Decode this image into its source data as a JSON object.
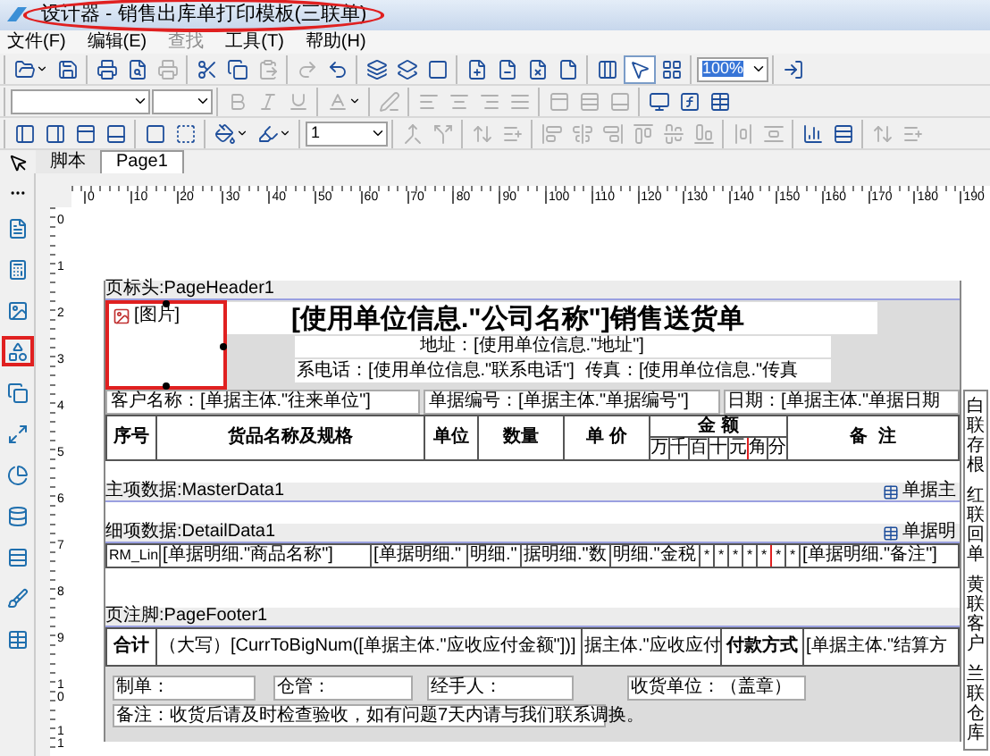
{
  "window": {
    "title": "设计器 - 销售出库单打印模板(三联单)",
    "title_circled": true
  },
  "menu": [
    {
      "label": "文件(F)",
      "disabled": false
    },
    {
      "label": "编辑(E)",
      "disabled": false
    },
    {
      "label": "查找",
      "disabled": true
    },
    {
      "label": "工具(T)",
      "disabled": false
    },
    {
      "label": "帮助(H)",
      "disabled": false
    }
  ],
  "toolbars": [
    [
      [
        {
          "kind": "button",
          "disabled": false,
          "caret": true
        },
        {
          "kind": "button",
          "disabled": false
        }
      ],
      [
        {
          "kind": "button",
          "disabled": false
        },
        {
          "kind": "button",
          "disabled": false
        },
        {
          "kind": "button",
          "disabled": true
        }
      ],
      [
        {
          "kind": "button",
          "disabled": false
        },
        {
          "kind": "button",
          "disabled": false
        },
        {
          "kind": "button",
          "disabled": true
        }
      ],
      [
        {
          "kind": "button",
          "disabled": true
        },
        {
          "kind": "button",
          "disabled": false
        }
      ],
      [
        {
          "kind": "button",
          "disabled": false
        },
        {
          "kind": "button",
          "disabled": false
        },
        {
          "kind": "button",
          "disabled": false
        }
      ],
      [
        {
          "kind": "button",
          "disabled": false
        },
        {
          "kind": "button",
          "disabled": false
        },
        {
          "kind": "button",
          "disabled": false
        },
        {
          "kind": "button",
          "disabled": false
        }
      ],
      [
        {
          "kind": "button",
          "disabled": false
        },
        {
          "kind": "button",
          "disabled": false,
          "pressed": true
        },
        {
          "kind": "button",
          "disabled": false
        }
      ],
      [
        {
          "kind": "select",
          "value": "100%",
          "highlighted": true
        }
      ],
      [
        {
          "kind": "button",
          "disabled": false
        }
      ]
    ],
    [
      [
        {
          "kind": "select"
        },
        {
          "kind": "select"
        }
      ],
      [
        {
          "kind": "button",
          "disabled": true
        },
        {
          "kind": "button",
          "disabled": true
        },
        {
          "kind": "button",
          "disabled": true
        }
      ],
      [
        {
          "kind": "button",
          "disabled": true,
          "caret": true
        }
      ],
      [
        {
          "kind": "button",
          "disabled": true
        }
      ],
      [
        {
          "kind": "button",
          "disabled": true
        },
        {
          "kind": "button",
          "disabled": true
        },
        {
          "kind": "button",
          "disabled": true
        },
        {
          "kind": "button",
          "disabled": true
        }
      ],
      [
        {
          "kind": "button",
          "disabled": true
        },
        {
          "kind": "button",
          "disabled": true
        },
        {
          "kind": "button",
          "disabled": true
        }
      ],
      [
        {
          "kind": "button",
          "disabled": false
        },
        {
          "kind": "button",
          "disabled": false
        },
        {
          "kind": "button",
          "disabled": false
        }
      ]
    ],
    [
      [
        {
          "kind": "button",
          "disabled": false
        },
        {
          "kind": "button",
          "disabled": false
        },
        {
          "kind": "button",
          "disabled": false
        },
        {
          "kind": "button",
          "disabled": false
        }
      ],
      [
        {
          "kind": "button",
          "disabled": false
        },
        {
          "kind": "button",
          "disabled": false
        }
      ],
      [
        {
          "kind": "button",
          "disabled": false,
          "caret": true
        },
        {
          "kind": "button",
          "disabled": false,
          "caret": true
        }
      ],
      [
        {
          "kind": "select",
          "value": "1",
          "highlighted": false
        }
      ],
      [
        {
          "kind": "button",
          "disabled": true
        },
        {
          "kind": "button",
          "disabled": true
        }
      ],
      [
        {
          "kind": "button",
          "disabled": true
        },
        {
          "kind": "button",
          "disabled": true
        }
      ],
      [
        {
          "kind": "button",
          "disabled": true
        },
        {
          "kind": "button",
          "disabled": true
        },
        {
          "kind": "button",
          "disabled": true
        },
        {
          "kind": "button",
          "disabled": true
        },
        {
          "kind": "button",
          "disabled": true
        },
        {
          "kind": "button",
          "disabled": true
        }
      ],
      [
        {
          "kind": "button",
          "disabled": true
        },
        {
          "kind": "button",
          "disabled": true
        }
      ],
      [
        {
          "kind": "button",
          "disabled": false
        },
        {
          "kind": "button",
          "disabled": false
        }
      ],
      [
        {
          "kind": "button",
          "disabled": true
        },
        {
          "kind": "button",
          "disabled": true
        }
      ]
    ]
  ],
  "tabs": [
    {
      "label": "脚本",
      "selected": false
    },
    {
      "label": "Page1",
      "selected": true
    }
  ],
  "palette": [
    {
      "selected": false
    },
    {
      "selected": false
    },
    {
      "selected": false
    },
    {
      "selected": true
    },
    {
      "selected": false
    },
    {
      "selected": false
    },
    {
      "selected": false
    },
    {
      "selected": false
    },
    {
      "selected": false
    },
    {
      "selected": false
    },
    {
      "selected": false
    }
  ],
  "ruler": {
    "horizontal": [
      "0",
      "10",
      "20",
      "30",
      "40",
      "50",
      "60",
      "70",
      "80",
      "90",
      "100",
      "110",
      "120",
      "130",
      "140",
      "150",
      "160",
      "170",
      "180",
      "190"
    ],
    "vertical": [
      "0",
      "1",
      "2",
      "3",
      "4",
      "5",
      "6",
      "7",
      "8",
      "9",
      "10",
      "11"
    ]
  },
  "page_header": {
    "label": "页标头:PageHeader1",
    "image": {
      "label": "[图片]",
      "selected": true
    },
    "title": "[使用单位信息.\"公司名称\"]销售送货单",
    "address": "地址：[使用单位信息.\"地址\"]",
    "phone": "系电话：[使用单位信息.\"联系电话\"]",
    "fax": "传真：[使用单位信息.\"传真",
    "customer": "客户名称：[单据主体.\"往来单位\"]",
    "number": "单据编号：[单据主体.\"单据编号\"]",
    "date": "日期：[单据主体.\"单据日期"
  },
  "table_header": {
    "columns": [
      "序号",
      "货品名称及规格",
      "单位",
      "数量",
      "单 价"
    ],
    "amount": {
      "label": "金 额",
      "digits": [
        "万",
        "千",
        "百",
        "十",
        "元",
        "角",
        "分"
      ]
    },
    "remark": "备  注"
  },
  "master": {
    "label": "主项数据:MasterData1",
    "tag": "单据主"
  },
  "detail": {
    "label": "细项数据:DetailData1",
    "tag": "单据明",
    "cells": [
      "RM_Lin",
      "[单据明细.\"商品名称\"]",
      "[单据明细.\"",
      "明细.\"",
      "据明细.\"数",
      "明细.\"金税"
    ],
    "digits": [
      "*",
      "*",
      "*",
      "*",
      "*",
      "*",
      "*"
    ],
    "remark": "[单据明细.\"备注\"]"
  },
  "page_footer": {
    "label": "页注脚:PageFooter1",
    "cells": [
      "合计",
      "（大写）[CurrToBigNum([单据主体.\"应收应付金额\"])]",
      "据主体.\"应收应付",
      "付款方式",
      "[单据主体.\"结算方"
    ],
    "signatures": [
      "制单：",
      "仓管：",
      "经手人：",
      "收货单位：（盖章）"
    ],
    "remark": "备注：收货后请及时检查验收，如有问题7天内请与我们联系调换。"
  },
  "copies": [
    "白联存根",
    "红联回单",
    "黄联客户",
    "兰联仓库"
  ]
}
